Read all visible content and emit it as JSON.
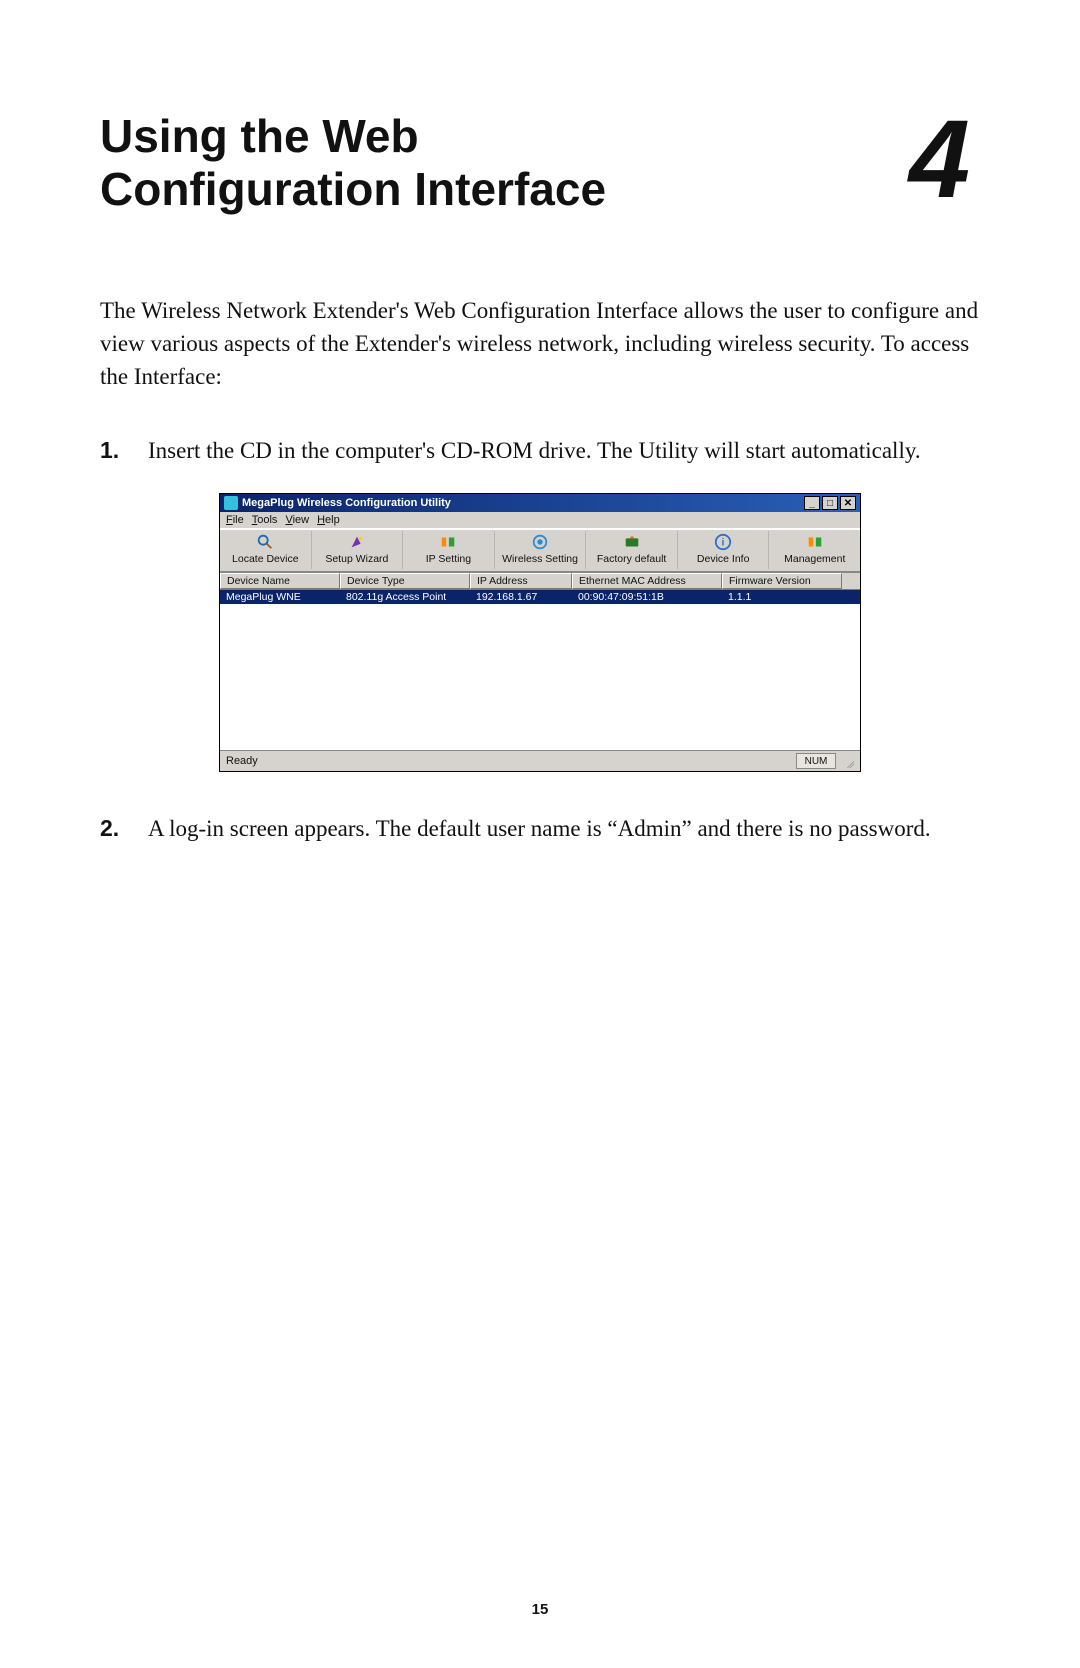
{
  "page_number": "15",
  "chapter": {
    "title_line1": "Using the Web",
    "title_line2": "Configuration Interface",
    "number": "4"
  },
  "intro": "The Wireless Network Extender's Web Configuration Interface allows the user to configure and view various aspects of the Extender's wireless network, including wireless security. To access the Interface:",
  "steps": [
    {
      "num": "1.",
      "text": "Insert the CD in the computer's CD-ROM drive. The Utility will start automatically."
    },
    {
      "num": "2.",
      "text": "A log-in screen appears. The default user name is “Admin” and there is no password."
    }
  ],
  "screenshot": {
    "title": "MegaPlug Wireless Configuration Utility",
    "menus": [
      {
        "label": "File",
        "key": "F"
      },
      {
        "label": "Tools",
        "key": "T"
      },
      {
        "label": "View",
        "key": "V"
      },
      {
        "label": "Help",
        "key": "H"
      }
    ],
    "toolbar": [
      {
        "label": "Locate Device",
        "icon_color": "#1e66b6"
      },
      {
        "label": "Setup Wizard",
        "icon_color": "#7a2fb4"
      },
      {
        "label": "IP Setting",
        "icon_color": "#2aa035"
      },
      {
        "label": "Wireless Setting",
        "icon_color": "#2f8bd0"
      },
      {
        "label": "Factory default",
        "icon_color": "#2a7a2a"
      },
      {
        "label": "Device Info",
        "icon_color": "#2a6fcf"
      },
      {
        "label": "Management",
        "icon_color": "#2aa035"
      }
    ],
    "columns": [
      "Device Name",
      "Device Type",
      "IP Address",
      "Ethernet MAC Address",
      "Firmware Version"
    ],
    "row": {
      "device_name": "MegaPlug WNE",
      "device_type": "802.11g Access Point",
      "ip_address": "192.168.1.67",
      "mac_address": "00:90:47:09:51:1B",
      "firmware": "1.1.1"
    },
    "status": "Ready",
    "indicator": "NUM"
  },
  "win_controls": {
    "minimize": "_",
    "maximize": "□",
    "close": "✕"
  }
}
